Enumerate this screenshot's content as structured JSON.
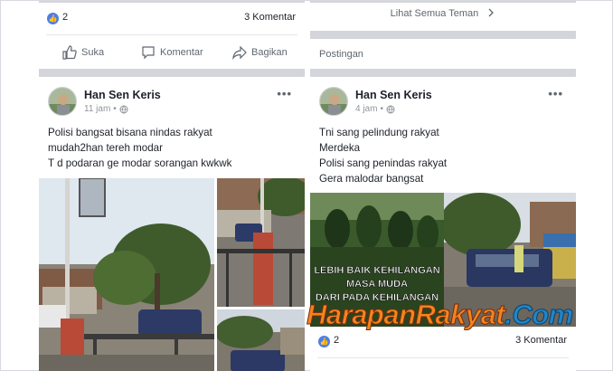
{
  "left_post_top": {
    "like_count": "2",
    "comment_count": "3 Komentar",
    "actions": {
      "like": "Suka",
      "comment": "Komentar",
      "share": "Bagikan"
    }
  },
  "left_post": {
    "author": "Han Sen Keris",
    "time": "11 jam",
    "lines": [
      "Polisi bangsat bisana nindas rakyat",
      "mudah2han tereh modar",
      "T d podaran ge modar sorangan kwkwk"
    ]
  },
  "right_top": {
    "see_all": "Lihat Semua Teman",
    "section_title": "Postingan"
  },
  "right_post": {
    "author": "Han Sen Keris",
    "time": "4 jam",
    "lines": [
      "Tni sang pelindung rakyat",
      "Merdeka",
      "Polisi sang penindas rakyat",
      "Gera malodar bangsat"
    ],
    "meme_text": [
      "LEBIH BAIK KEHILANGAN",
      "MASA MUDA",
      "DARI PADA KEHILANGAN"
    ],
    "like_count": "2",
    "comment_count": "3 Komentar"
  },
  "watermark": {
    "part1": "HarapanRakyat",
    "part2": ".Com"
  },
  "icons": {
    "like": "thumbs-up-icon",
    "comment": "speech-bubble-icon",
    "share": "share-arrow-icon",
    "globe": "globe-icon",
    "more": "more-dots-icon",
    "chevron": "chevron-right-icon"
  },
  "colors": {
    "like_badge": "#4d7ee9",
    "separator": "#d3d5da",
    "secondary_text": "#606770"
  }
}
